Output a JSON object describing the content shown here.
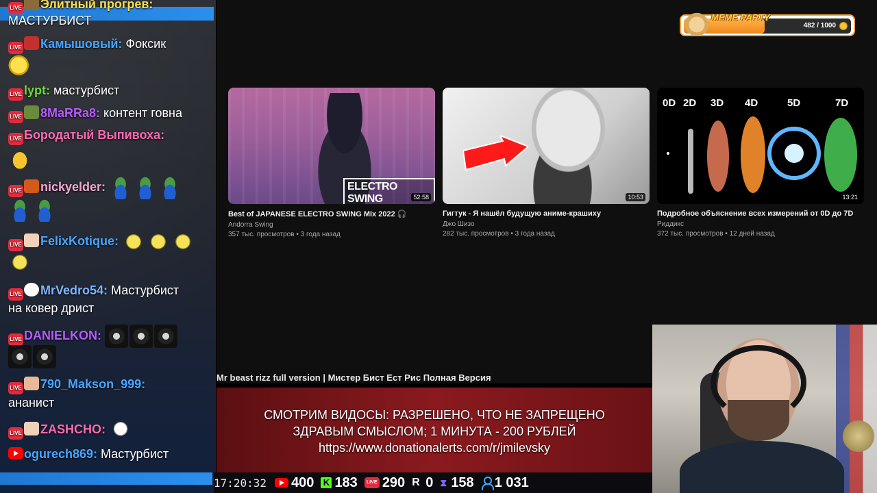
{
  "chat": {
    "messages": [
      {
        "nick": "Элитный прогрев:",
        "text": "",
        "color": "#f3e055",
        "badge": "live"
      },
      {
        "nick": "",
        "text": "МАСТУРБИСТ",
        "color": "#ffffff",
        "badge": "none"
      },
      {
        "nick": "Камышовый:",
        "text": " Фоксик",
        "color": "#49a5ff",
        "badge": "live"
      },
      {
        "nick": "lypt:",
        "text": " мастурбист",
        "color": "#6edc3c",
        "badge": "live"
      },
      {
        "nick": "8MaRRa8:",
        "text": " контент говна",
        "color": "#b75cff",
        "badge": "live"
      },
      {
        "nick": "Бородатый Выпивоха:",
        "text": "",
        "color": "#ff6bb3",
        "badge": "live"
      },
      {
        "nick": "nickyelder:",
        "text": "",
        "color": "#f0a8d0",
        "badge": "live"
      },
      {
        "nick": "FelixKotique:",
        "text": "",
        "color": "#49a5ff",
        "badge": "live"
      },
      {
        "nick": "MrVedro54:",
        "text": " Мастурбист",
        "color": "#7fb5ff",
        "badge": "live"
      },
      {
        "nick": "",
        "text": "на ковер дрист",
        "color": "#ffffff",
        "badge": "none"
      },
      {
        "nick": "DANIELKON:",
        "text": "",
        "color": "#b75cff",
        "badge": "live"
      },
      {
        "nick": "790_Makson_999:",
        "text": "",
        "color": "#49a5ff",
        "badge": "live"
      },
      {
        "nick": "",
        "text": "ананист",
        "color": "#ffffff",
        "badge": "none"
      },
      {
        "nick": "ZASHCHO:",
        "text": "",
        "color": "#ff6bb3",
        "badge": "live"
      },
      {
        "nick": "ogurech869:",
        "text": " Мастурбист",
        "color": "#49a5ff",
        "badge": "yt"
      }
    ]
  },
  "meme_party": {
    "title": "MEME PARTY",
    "progress_text": "482 / 1000",
    "progress": 0.482
  },
  "videos": [
    {
      "title": "Best of JAPANESE ELECTRO SWING Mix 2022 🎧",
      "channel": "Andorra Swing",
      "meta": "357 тыс. просмотров • 3 года назад",
      "duration": "52:58",
      "overlay": "ELECTRO SWING"
    },
    {
      "title": "Гигтук - Я нашёл будущую аниме-крашиху",
      "channel": "Джо Шизо",
      "meta": "282 тыс. просмотров • 3 года назад",
      "duration": "10:53"
    },
    {
      "title": "Подробное объяснение всех измерений от 0D до 7D",
      "channel": "Риддикс",
      "meta": "372 тыс. просмотров • 12 дней назад",
      "duration": "13:21",
      "dimensions": [
        "0D",
        "2D",
        "3D",
        "4D",
        "5D",
        "7D"
      ]
    }
  ],
  "bottom_video_title": "Mr beast rizz full version | Мистер Бист Ест Рис Полная Версия",
  "banner": {
    "line1": "СМОТРИМ ВИДОСЫ: РАЗРЕШЕНО, ЧТО НЕ ЗАПРЕЩЕНО",
    "line2": "ЗДРАВЫМ СМЫСЛОМ; 1 МИНУТА - 200 РУБЛЕЙ",
    "line3": "https://www.donationalerts.com/r/jmilevsky"
  },
  "stats": {
    "clock": "17:20:32",
    "youtube": "400",
    "kick": "183",
    "vk_live": "290",
    "rutube": "0",
    "trovo": "158",
    "total": "1 031"
  },
  "colors": {
    "live_badge": "#e62a3b",
    "chat_accent": "#1f78d1",
    "banner": "#8a1a1f",
    "meme_fill": "#f0861d"
  },
  "icons": {
    "live": "live-badge-icon",
    "youtube": "youtube-icon",
    "kick": "kick-icon",
    "rutube": "rutube-icon",
    "trovo": "hourglass-icon",
    "viewers": "user-icon"
  }
}
